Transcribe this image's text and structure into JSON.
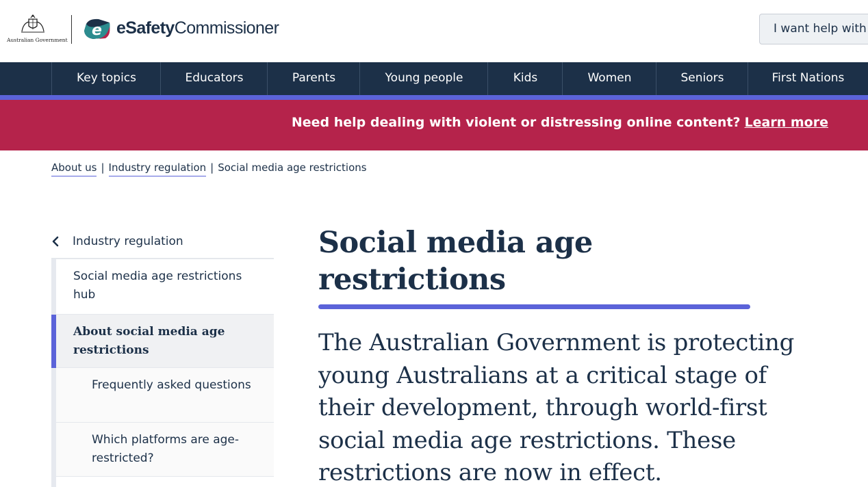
{
  "header": {
    "gov_logo_text": "Australian Government",
    "brand_name_bold": "eSafety",
    "brand_name_rest": "Commissioner",
    "help_button_label": "I want help with"
  },
  "nav": {
    "items": [
      {
        "label": "Key topics"
      },
      {
        "label": "Educators"
      },
      {
        "label": "Parents"
      },
      {
        "label": "Young people"
      },
      {
        "label": "Kids"
      },
      {
        "label": "Women"
      },
      {
        "label": "Seniors"
      },
      {
        "label": "First Nations"
      }
    ]
  },
  "alert": {
    "text": "Need help dealing with violent or distressing online content?",
    "link_label": "Learn more"
  },
  "breadcrumb": {
    "items": [
      {
        "label": "About us"
      },
      {
        "label": "Industry regulation"
      },
      {
        "label": "Social media age restrictions"
      }
    ],
    "separator": "|"
  },
  "sidebar": {
    "parent_label": "Industry regulation",
    "items": [
      {
        "label": "Social media age restrictions hub"
      },
      {
        "label": "About social media age restrictions"
      },
      {
        "label": "Frequently asked questions"
      },
      {
        "label": "Which platforms are age-restricted?"
      }
    ]
  },
  "main": {
    "title": "Social media age restrictions",
    "lead": "The Australian Government is protecting young Australians at a critical stage of their development, through world-first social media age restrictions. These restrictions are now in effect."
  },
  "colors": {
    "navy": "#1c3048",
    "accent": "#5b63d9",
    "alert": "#b5234b"
  }
}
